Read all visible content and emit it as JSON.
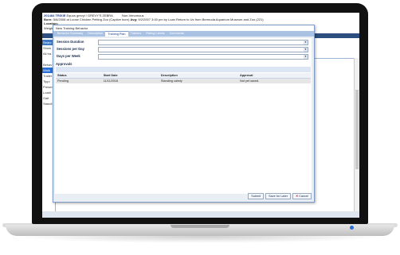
{
  "header": {
    "animal_id": "201484",
    "animal_name": "TRIXIE",
    "species": "Equus grevyi / GREVY'S ZEBRA",
    "status": "Non-Venomous",
    "born_label": "Born:",
    "born_text": "5/6/2008 at Loose Chicken Petting Zoo (Captive born)",
    "avg_label": "Avg:",
    "avg_text": "9/2/2007 3:00 pm by Loan Return to Us from Bermuda Aquarium Museum and Zoo (221)",
    "location_label": "Location:",
    "weight_label": "Weight:"
  },
  "app_tabs": [
    "Training"
  ],
  "left_rows": [
    "Searc",
    "Show",
    "All tra"
  ],
  "left_list": [
    "Behav",
    "Walk",
    "Trailer",
    "Tippi",
    "Presen",
    "Loadi",
    "Gait",
    "Standi"
  ],
  "dialog": {
    "title": "New Training Behavior",
    "tabs": [
      "Behavior Summary",
      "Description",
      "Training Plan",
      "Trainers",
      "Rating Labels",
      "Comments"
    ],
    "active_tab": "Training Plan",
    "fields": [
      {
        "label": "Session Duration",
        "value": ""
      },
      {
        "label": "Sessions per Day",
        "value": ""
      },
      {
        "label": "Days per Week",
        "value": ""
      }
    ],
    "approvals_label": "Approvals",
    "toolbar": {
      "insert": "Insert",
      "edit": "Edit",
      "delete": "Delete"
    },
    "table_headers": [
      "Status",
      "Start Date",
      "Description",
      "Approval"
    ],
    "table_rows": [
      [
        "Pending",
        "11/11/2016",
        "Standing calmly",
        "Not yet saved."
      ]
    ],
    "footer": {
      "submit": "Submit",
      "save_for_later": "Save for Later",
      "cancel": "Cancel"
    }
  }
}
